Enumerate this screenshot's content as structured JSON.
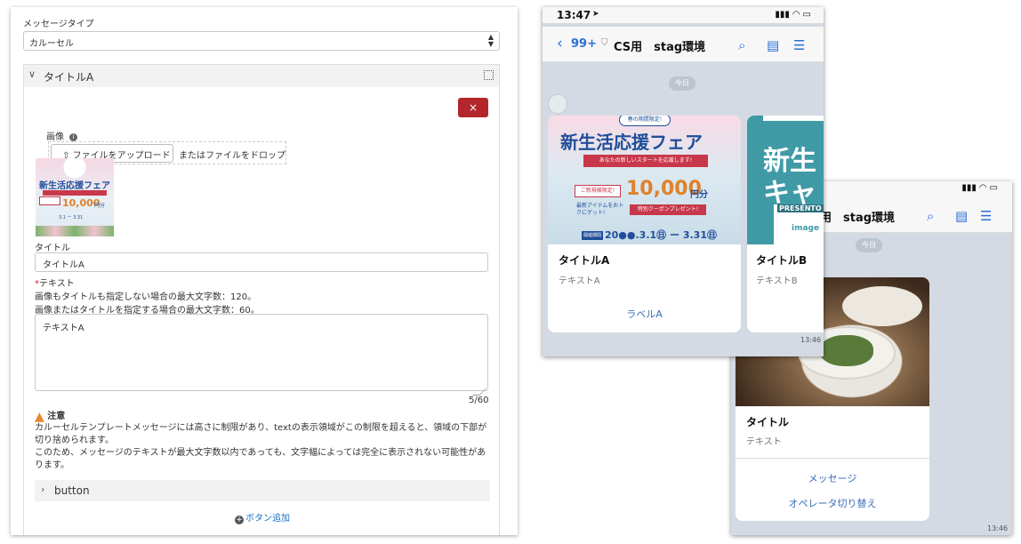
{
  "editor": {
    "message_type_label": "メッセージタイプ",
    "message_type_value": "カルーセル",
    "column_title": "タイトルA",
    "delete_label": "×",
    "image_label": "画像",
    "info_icon": "i",
    "upload_button": "ファイルをアップロード",
    "upload_drop": "またはファイルをドロップ",
    "title_label": "タイトル",
    "title_value": "タイトルA",
    "text_label": "テキスト",
    "text_required_mark": "*",
    "text_hint_1": "画像もタイトルも指定しない場合の最大文字数：120。",
    "text_hint_2": "画像またはタイトルを指定する場合の最大文字数：60。",
    "text_value": "テキストA",
    "char_count": "5/60",
    "notice_title": "注意",
    "notice_body_1": "カルーセルテンプレートメッセージには高さに制限があり、textの表示領域がこの制限を超えると、領域の下部が切り捨められます。",
    "notice_body_2": "このため、メッセージのテキストが最大文字数以内であっても、文字幅によっては完全に表示されない可能性があります。",
    "button_section": "button",
    "add_button": "ボタン追加"
  },
  "thumbnail": {
    "headline": "新生活応援フェア",
    "price": "10,000",
    "price_unit": "円分",
    "dates": "3.1 ー 3.31"
  },
  "phone1": {
    "time": "13:47",
    "back_count": "99+",
    "title": "CS用　stag環境",
    "day_label": "今日",
    "banner": {
      "ribbon": "春の期間限定!",
      "headline": "新生活応援フェア",
      "sub": "あなたの新しいスタートを応援します!",
      "tag": "ご新規様限定!",
      "price": "10,000",
      "price_unit": "円分",
      "coupon": "特別クーポンプレゼント!",
      "small": "最新アイテムをおトクにゲット!",
      "period_tag": "開催期間",
      "period": "20●●.3.1㊐ ー 3.31㊐"
    },
    "cards": [
      {
        "title": "タイトルA",
        "text": "テキストA",
        "action": "ラベルA"
      },
      {
        "title": "タイトルB",
        "text": "テキストB",
        "image_chars": "新生",
        "image_chars2": "キャ",
        "image_word": "image",
        "image_banner": "PRESENTO"
      }
    ],
    "timestamp": "13:46"
  },
  "phone2": {
    "title": "用　stag環境",
    "day_label": "今日",
    "card": {
      "title": "タイトル",
      "text": "テキスト",
      "actions": [
        "メッセージ",
        "オペレータ切り替え"
      ]
    },
    "timestamp": "13:46"
  }
}
